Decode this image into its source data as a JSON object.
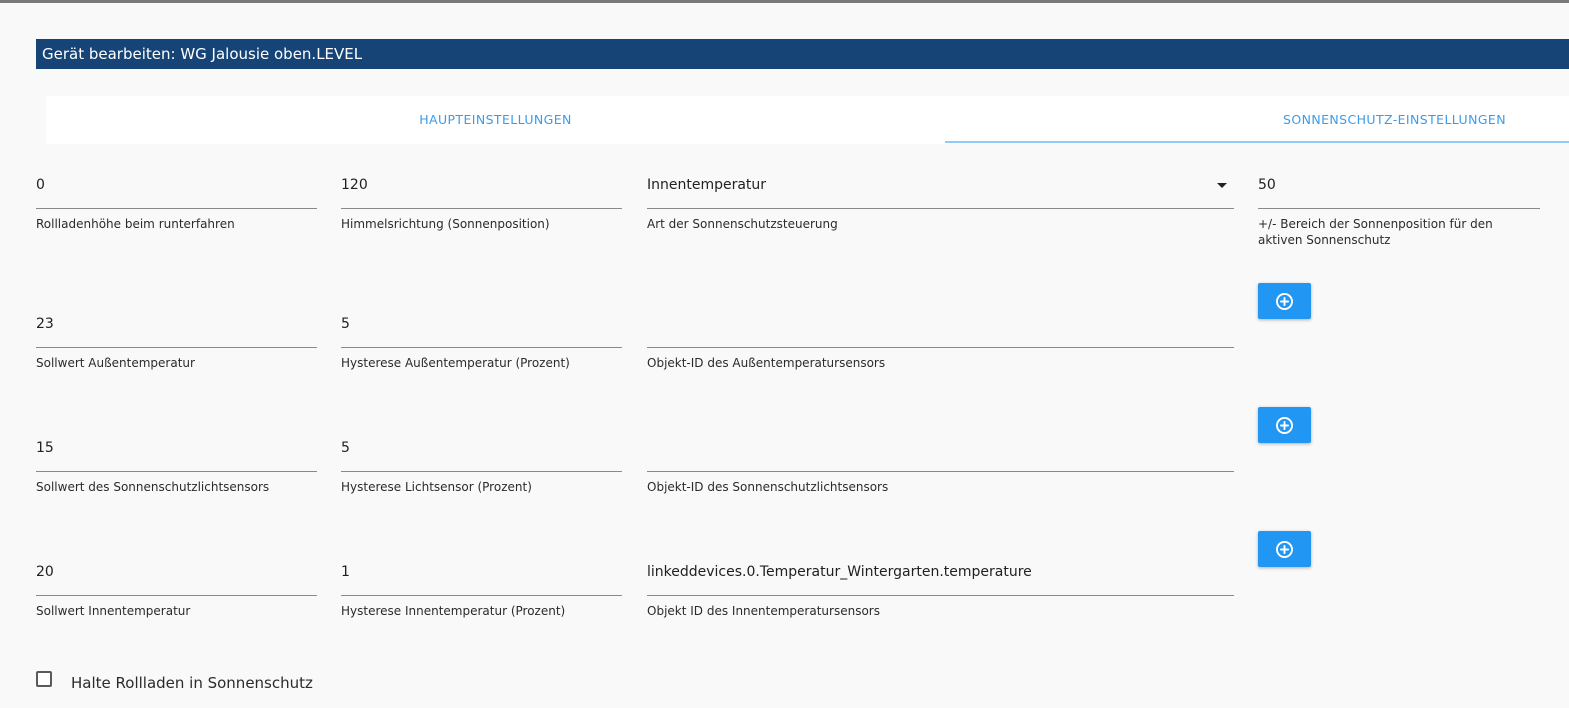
{
  "dialog": {
    "title": "Gerät bearbeiten: WG Jalousie oben.LEVEL"
  },
  "tabs": [
    {
      "label": "HAUPTEINSTELLUNGEN",
      "active": false
    },
    {
      "label": "SONNENSCHUTZ-EINSTELLUNGEN",
      "active": true
    }
  ],
  "colors": {
    "title_bg": "#164477",
    "tab_text": "#3d9be9",
    "button_bg": "#2196f3"
  },
  "fields": {
    "shutter_height": {
      "value": "0",
      "label": "Rollladenhöhe beim runterfahren"
    },
    "sun_direction": {
      "value": "120",
      "label": "Himmelsrichtung (Sonnenposition)"
    },
    "sun_mode": {
      "value": "Innentemperatur",
      "label": "Art der Sonnenschutzsteuerung"
    },
    "sun_range": {
      "value": "50",
      "label": "+/- Bereich der Sonnenposition für den aktiven Sonnenschutz"
    },
    "outside_temp_setpoint": {
      "value": "23",
      "label": "Sollwert Außentemperatur"
    },
    "outside_temp_hysteresis": {
      "value": "5",
      "label": "Hysterese Außentemperatur (Prozent)"
    },
    "outside_temp_sensor": {
      "value": "",
      "label": "Objekt-ID des Außentemperatursensors"
    },
    "light_setpoint": {
      "value": "15",
      "label": "Sollwert des Sonnenschutzlichtsensors"
    },
    "light_hysteresis": {
      "value": "5",
      "label": "Hysterese Lichtsensor (Prozent)"
    },
    "light_sensor": {
      "value": "",
      "label": "Objekt-ID des Sonnenschutzlichtsensors"
    },
    "inside_temp_setpoint": {
      "value": "20",
      "label": "Sollwert Innentemperatur"
    },
    "inside_temp_hysteresis": {
      "value": "1",
      "label": "Hysterese Innentemperatur (Prozent)"
    },
    "inside_temp_sensor": {
      "value": "linkeddevices.0.Temperatur_Wintergarten.temperature",
      "label": "Objekt ID des Innentemperatursensors"
    }
  },
  "icons": {
    "add_button_icon": "add-circle-icon",
    "select_caret": "caret-down-icon"
  },
  "checkbox": {
    "label": "Halte Rollladen in Sonnenschutz",
    "checked": false
  }
}
